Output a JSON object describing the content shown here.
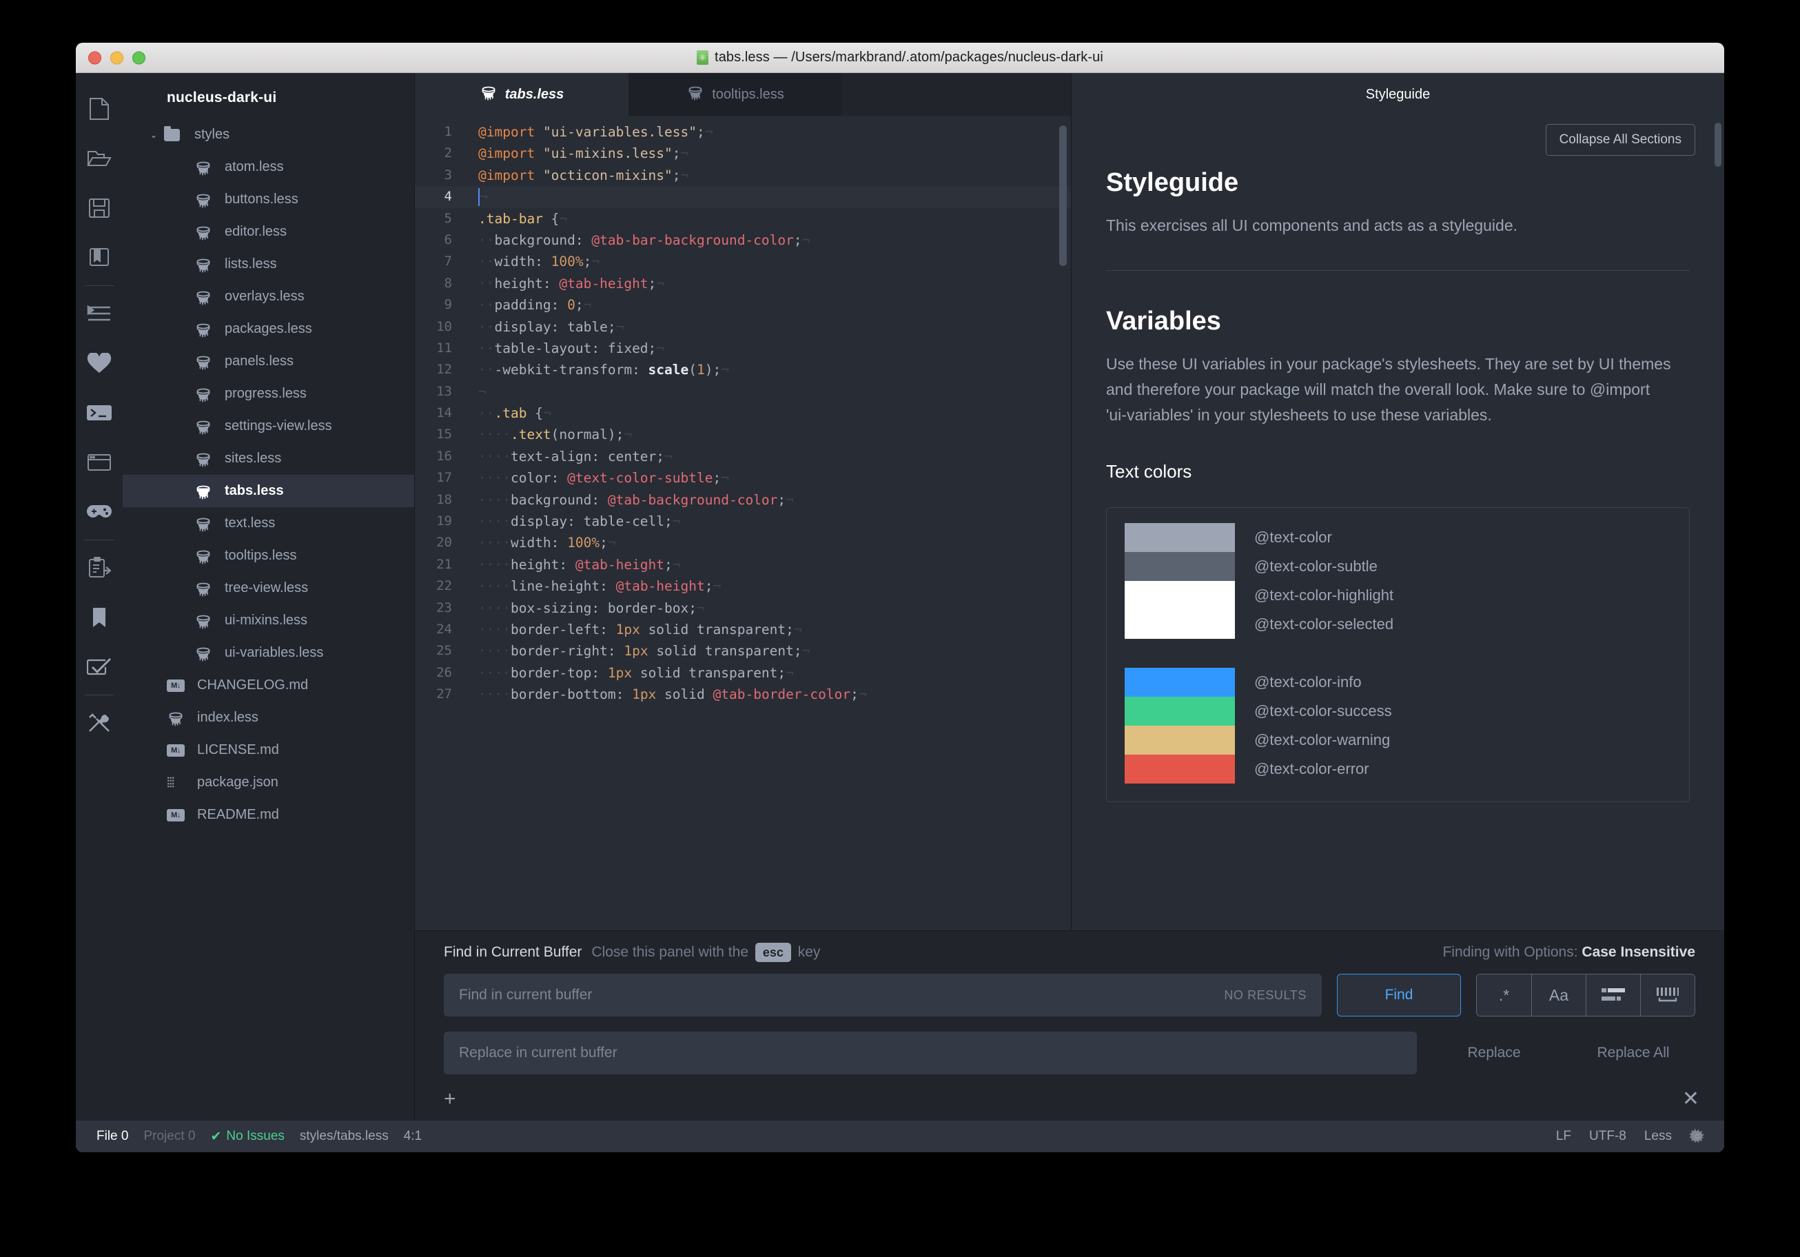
{
  "window": {
    "title": "tabs.less — /Users/markbrand/.atom/packages/nucleus-dark-ui",
    "title_icon": "atom-file-icon"
  },
  "rail": {
    "items": [
      {
        "name": "new-file-icon"
      },
      {
        "name": "open-folder-icon"
      },
      {
        "name": "save-icon"
      },
      {
        "name": "book-icon"
      },
      {
        "name": "indent-icon"
      },
      {
        "name": "heart-icon"
      },
      {
        "name": "terminal-icon"
      },
      {
        "name": "window-icon"
      },
      {
        "name": "game-controller-icon"
      },
      {
        "name": "clipboard-import-icon"
      },
      {
        "name": "bookmark-icon"
      },
      {
        "name": "checkbox-icon"
      },
      {
        "name": "tools-icon"
      }
    ]
  },
  "tree": {
    "project": "nucleus-dark-ui",
    "folder": {
      "label": "styles",
      "expanded": true,
      "twisty": "⌄"
    },
    "items": [
      {
        "label": "atom.less",
        "icon": "less-file-icon",
        "depth": 2,
        "selected": false
      },
      {
        "label": "buttons.less",
        "icon": "less-file-icon",
        "depth": 2,
        "selected": false
      },
      {
        "label": "editor.less",
        "icon": "less-file-icon",
        "depth": 2,
        "selected": false
      },
      {
        "label": "lists.less",
        "icon": "less-file-icon",
        "depth": 2,
        "selected": false
      },
      {
        "label": "overlays.less",
        "icon": "less-file-icon",
        "depth": 2,
        "selected": false
      },
      {
        "label": "packages.less",
        "icon": "less-file-icon",
        "depth": 2,
        "selected": false
      },
      {
        "label": "panels.less",
        "icon": "less-file-icon",
        "depth": 2,
        "selected": false
      },
      {
        "label": "progress.less",
        "icon": "less-file-icon",
        "depth": 2,
        "selected": false
      },
      {
        "label": "settings-view.less",
        "icon": "less-file-icon",
        "depth": 2,
        "selected": false
      },
      {
        "label": "sites.less",
        "icon": "less-file-icon",
        "depth": 2,
        "selected": false
      },
      {
        "label": "tabs.less",
        "icon": "less-file-icon",
        "depth": 2,
        "selected": true
      },
      {
        "label": "text.less",
        "icon": "less-file-icon",
        "depth": 2,
        "selected": false
      },
      {
        "label": "tooltips.less",
        "icon": "less-file-icon",
        "depth": 2,
        "selected": false
      },
      {
        "label": "tree-view.less",
        "icon": "less-file-icon",
        "depth": 2,
        "selected": false
      },
      {
        "label": "ui-mixins.less",
        "icon": "less-file-icon",
        "depth": 2,
        "selected": false
      },
      {
        "label": "ui-variables.less",
        "icon": "less-file-icon",
        "depth": 2,
        "selected": false
      },
      {
        "label": "CHANGELOG.md",
        "icon": "markdown-file-icon",
        "depth": 1,
        "selected": false
      },
      {
        "label": "index.less",
        "icon": "less-file-icon",
        "depth": 1,
        "selected": false
      },
      {
        "label": "LICENSE.md",
        "icon": "markdown-file-icon",
        "depth": 1,
        "selected": false
      },
      {
        "label": "package.json",
        "icon": "json-file-icon",
        "depth": 1,
        "selected": false
      },
      {
        "label": "README.md",
        "icon": "markdown-file-icon",
        "depth": 1,
        "selected": false
      }
    ]
  },
  "editor": {
    "tabs": [
      {
        "label": "tabs.less",
        "active": true,
        "icon": "less-file-icon"
      },
      {
        "label": "tooltips.less",
        "active": false,
        "icon": "less-file-icon"
      }
    ],
    "lines": [
      {
        "n": "1",
        "cur": false
      },
      {
        "n": "2",
        "cur": false
      },
      {
        "n": "3",
        "cur": false
      },
      {
        "n": "4",
        "cur": true
      },
      {
        "n": "5",
        "cur": false
      },
      {
        "n": "6",
        "cur": false
      },
      {
        "n": "7",
        "cur": false
      },
      {
        "n": "8",
        "cur": false
      },
      {
        "n": "9",
        "cur": false
      },
      {
        "n": "10",
        "cur": false
      },
      {
        "n": "11",
        "cur": false
      },
      {
        "n": "12",
        "cur": false
      },
      {
        "n": "13",
        "cur": false
      },
      {
        "n": "14",
        "cur": false
      },
      {
        "n": "15",
        "cur": false
      },
      {
        "n": "16",
        "cur": false
      },
      {
        "n": "17",
        "cur": false
      },
      {
        "n": "18",
        "cur": false
      },
      {
        "n": "19",
        "cur": false
      },
      {
        "n": "20",
        "cur": false
      },
      {
        "n": "21",
        "cur": false
      },
      {
        "n": "22",
        "cur": false
      },
      {
        "n": "23",
        "cur": false
      },
      {
        "n": "24",
        "cur": false
      },
      {
        "n": "25",
        "cur": false
      },
      {
        "n": "26",
        "cur": false
      },
      {
        "n": "27",
        "cur": false
      }
    ],
    "source": [
      "@import \"ui-variables.less\";",
      "@import \"ui-mixins.less\";",
      "@import \"octicon-mixins\";",
      "",
      ".tab-bar {",
      "  background: @tab-bar-background-color;",
      "  width: 100%;",
      "  height: @tab-height;",
      "  padding: 0;",
      "  display: table;",
      "  table-layout: fixed;",
      "  -webkit-transform: scale(1);",
      "",
      "  .tab {",
      "    .text(normal);",
      "    text-align: center;",
      "    color: @text-color-subtle;",
      "    background: @tab-background-color;",
      "    display: table-cell;",
      "    width: 100%;",
      "    height: @tab-height;",
      "    line-height: @tab-height;",
      "    box-sizing: border-box;",
      "    border-left: 1px solid transparent;",
      "    border-right: 1px solid transparent;",
      "    border-top: 1px solid transparent;",
      "    border-bottom: 1px solid @tab-border-color;"
    ]
  },
  "guide": {
    "tab_label": "Styleguide",
    "collapse_button": "Collapse All Sections",
    "heading": "Styleguide",
    "intro": "This exercises all UI components and acts as a styleguide.",
    "variables_heading": "Variables",
    "variables_text": "Use these UI variables in your package's stylesheets. They are set by UI themes and therefore your package will match the overall look. Make sure to @import 'ui-variables' in your stylesheets to use these variables.",
    "text_colors_heading": "Text colors",
    "swatch_groups": [
      {
        "rows": [
          {
            "label": "@text-color",
            "color": "#9da5b4"
          },
          {
            "label": "@text-color-subtle",
            "color": "#5c6370"
          },
          {
            "label": "@text-color-highlight",
            "color": "#ffffff"
          },
          {
            "label": "@text-color-selected",
            "color": "#ffffff"
          }
        ]
      },
      {
        "rows": [
          {
            "label": "@text-color-info",
            "color": "#3098ff"
          },
          {
            "label": "@text-color-success",
            "color": "#3ecf8e"
          },
          {
            "label": "@text-color-warning",
            "color": "#e0c080"
          },
          {
            "label": "@text-color-error",
            "color": "#e4564a"
          }
        ]
      }
    ]
  },
  "find": {
    "title": "Find in Current Buffer",
    "hint_before": "Close this panel with the",
    "hint_key": "esc",
    "hint_after": "key",
    "options_prefix": "Finding with Options:",
    "options_value": "Case Insensitive",
    "find_placeholder": "Find in current buffer",
    "find_value": "",
    "no_results": "NO RESULTS",
    "find_button": "Find",
    "option_buttons": [
      {
        "name": "regex-option-button",
        "glyph": ".*"
      },
      {
        "name": "case-sensitive-option-button",
        "glyph": "Aa"
      },
      {
        "name": "selection-only-option-button",
        "glyph": "selection-icon"
      },
      {
        "name": "whole-word-option-button",
        "glyph": "whole-word-icon"
      }
    ],
    "replace_placeholder": "Replace in current buffer",
    "replace_value": "",
    "replace_button": "Replace",
    "replace_all_button": "Replace All",
    "add_button": "+",
    "close_button": "✕"
  },
  "status": {
    "file_label": "File",
    "file_count": "0",
    "project_label": "Project",
    "project_count": "0",
    "issues_check": "✔",
    "issues_text": "No Issues",
    "path": "styles/tabs.less",
    "cursor": "4:1",
    "line_ending": "LF",
    "encoding": "UTF-8",
    "grammar": "Less",
    "settings_icon": "gear-icon"
  }
}
